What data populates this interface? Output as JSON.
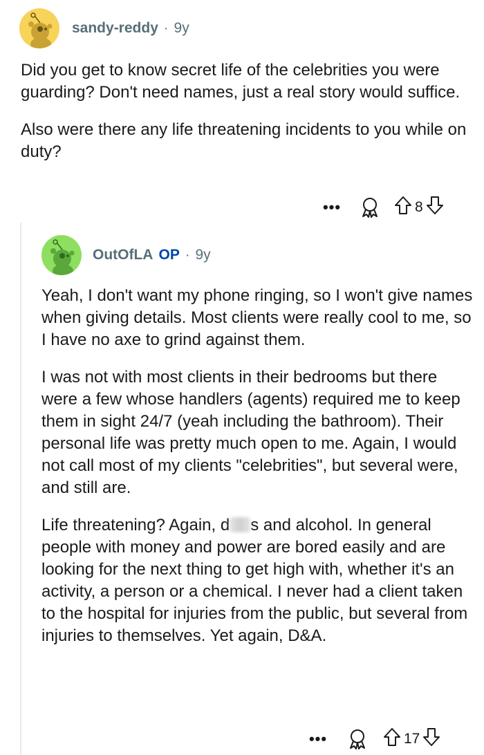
{
  "comment1": {
    "username": "sandy-reddy",
    "age": "9y",
    "paragraphs": [
      "Did you get to know secret life of the celebrities you were guarding? Don't need names, just a real story would suffice.",
      "Also were there any life threatening incidents to you while on duty?"
    ],
    "more_label": "•••",
    "vote_count": "8",
    "avatar_color": "#f7d35a"
  },
  "comment2": {
    "username": "OutOfLA",
    "op_badge": "OP",
    "age": "9y",
    "paragraph1": "Yeah, I don't want my phone ringing, so I won't give names when giving details. Most clients were really cool to me, so I have no axe to grind against them.",
    "paragraph2": "I was not with most clients in their bedrooms but there were a few whose handlers (agents) required me to keep them in sight 24/7 (yeah including the bathroom). Their personal life was pretty much open to me. Again, I would not call most of my clients \"celebrities\", but several were, and still are.",
    "paragraph3_before": "Life threatening? Again, d",
    "paragraph3_after": "s and alcohol. In general people with money and power are bored easily and are looking for the next thing to get high with, whether it's an activity, a person or a chemical. I never had a client taken to the hospital for injuries from the public, but several from injuries to themselves. Yet again, D&A.",
    "more_label": "•••",
    "vote_count": "17",
    "avatar_color": "#8ede5f"
  },
  "icons": {
    "more": "ellipsis-icon",
    "award": "award-icon",
    "upvote": "upvote-arrow-icon",
    "downvote": "downvote-arrow-icon"
  }
}
